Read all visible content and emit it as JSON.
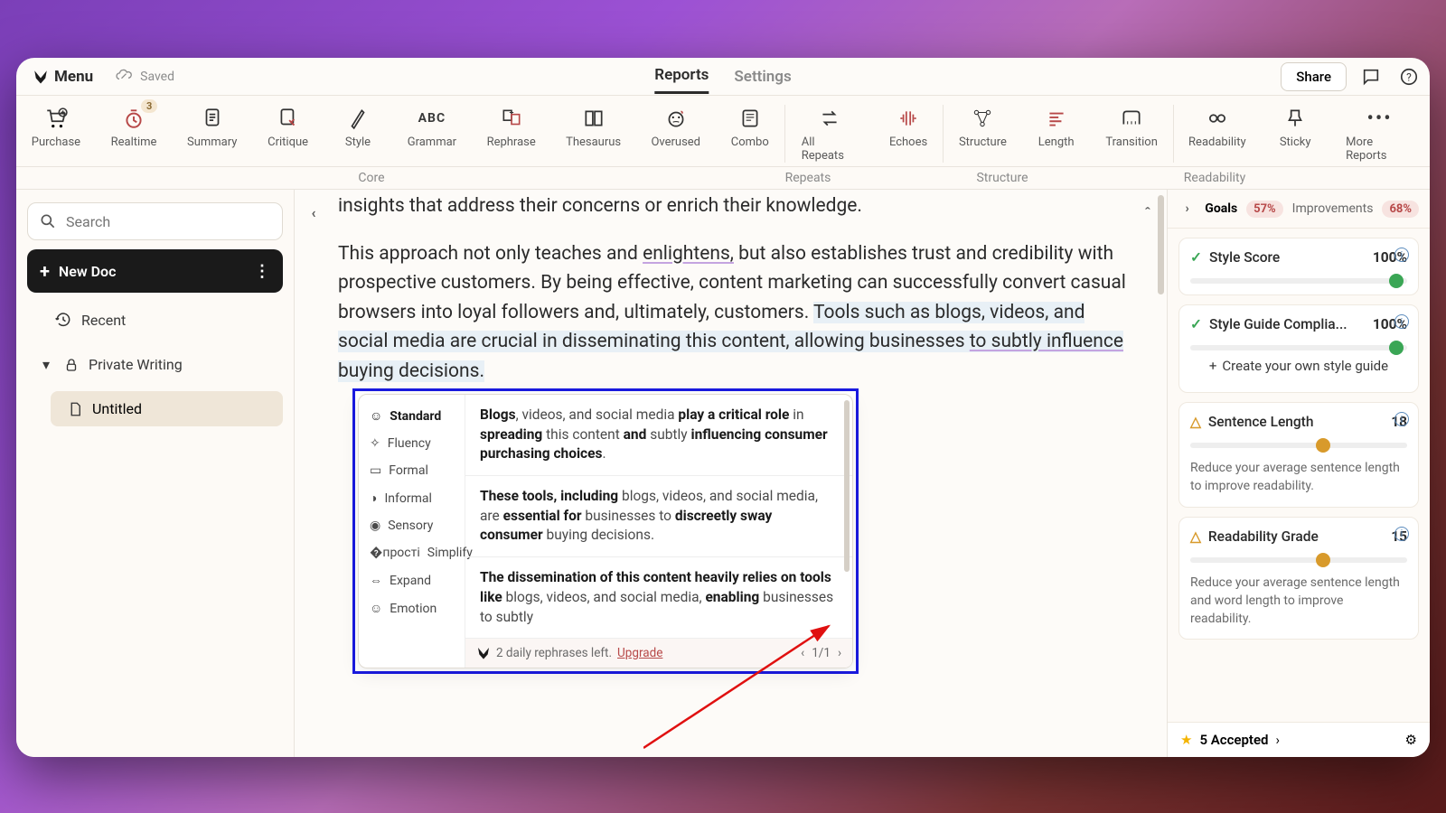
{
  "topbar": {
    "menu": "Menu",
    "saved": "Saved",
    "tabs": [
      "Reports",
      "Settings"
    ],
    "active_tab": 0,
    "share": "Share"
  },
  "toolbar": {
    "items": [
      {
        "label": "Purchase"
      },
      {
        "label": "Realtime",
        "badge": "3"
      },
      {
        "label": "Summary"
      },
      {
        "label": "Critique"
      },
      {
        "label": "Style"
      },
      {
        "label": "Grammar",
        "text_icon": "ABC"
      },
      {
        "label": "Rephrase"
      },
      {
        "label": "Thesaurus"
      },
      {
        "label": "Overused"
      },
      {
        "label": "Combo"
      },
      {
        "label": "All Repeats"
      },
      {
        "label": "Echoes"
      },
      {
        "label": "Structure"
      },
      {
        "label": "Length"
      },
      {
        "label": "Transition"
      },
      {
        "label": "Readability"
      },
      {
        "label": "Sticky"
      },
      {
        "label": "More Reports"
      }
    ],
    "groups": [
      "Core",
      "Repeats",
      "Structure",
      "Readability"
    ]
  },
  "sidebar": {
    "search_placeholder": "Search",
    "newdoc": "New Doc",
    "recent": "Recent",
    "section": "Private Writing",
    "file": "Untitled"
  },
  "document": {
    "line1": "insights that address their concerns or enrich their knowledge.",
    "p2_a": "This approach not only teaches and ",
    "p2_u": "enlightens,",
    "p2_b": " but also establishes trust and credibility with prospective customers. By being effective, content marketing can successfully convert casual browsers into loyal followers and, ultimately, customers. ",
    "p2_hl1": "Tools such as blogs, videos, and social media are crucial in disseminating this content, allowing businesses ",
    "p2_hlU": "to subtly influence",
    "p2_hl2": " buying decisions."
  },
  "rephrase": {
    "modes": [
      "Standard",
      "Fluency",
      "Formal",
      "Informal",
      "Sensory",
      "Simplify",
      "Expand",
      "Emotion"
    ],
    "active_mode": 0,
    "suggestions": [
      {
        "pre": "Blogs",
        "mid1": ", videos, and social media ",
        "b1": "play a critical role",
        "mid2": " in ",
        "b2": "spreading",
        "mid3": " this content ",
        "b3": "and",
        "mid4": " subtly ",
        "b4": "influencing consumer purchasing choices",
        "end": "."
      },
      {
        "b1": "These tools, including",
        "mid1": " blogs, videos, and social media",
        "mid2": ", are ",
        "b2": "essential for",
        "mid3": " businesses to ",
        "b3": "discreetly sway consumer",
        "mid4": " buying decisions."
      },
      {
        "b1": "The dissemination of this content heavily relies on tools like",
        "mid1": " blogs, videos, and social media",
        "mid2": ", ",
        "b2": "enabling",
        "mid3": " businesses to subtly"
      }
    ],
    "footer_text": "2 daily rephrases left.",
    "upgrade": "Upgrade",
    "pager": "1/1"
  },
  "right": {
    "goals": "Goals",
    "goals_pct": "57%",
    "improvements": "Improvements",
    "improvements_pct": "68%",
    "cards": [
      {
        "title": "Style Score",
        "value": "100%",
        "status": "ok"
      },
      {
        "title": "Style Guide Complia...",
        "value": "100%",
        "status": "ok",
        "extra": "Create your own style guide"
      },
      {
        "title": "Sentence Length",
        "value": "18",
        "status": "warn",
        "sub": "Reduce your average sentence length to improve readability."
      },
      {
        "title": "Readability Grade",
        "value": "15",
        "status": "warn",
        "sub": "Reduce your average sentence length and word length to improve readability."
      }
    ],
    "accepted": "5 Accepted"
  }
}
